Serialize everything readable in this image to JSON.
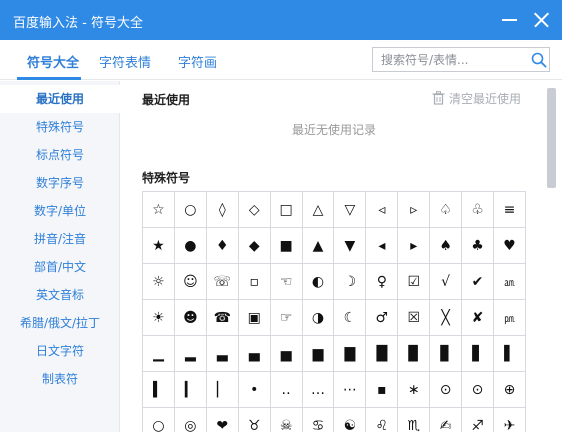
{
  "window": {
    "title": "百度输入法 - 符号大全"
  },
  "tabs": [
    {
      "label": "符号大全",
      "active": true
    },
    {
      "label": "字符表情",
      "active": false
    },
    {
      "label": "字符画",
      "active": false
    }
  ],
  "search": {
    "placeholder": "搜索符号/表情...",
    "value": ""
  },
  "sidebar": {
    "items": [
      {
        "label": "最近使用",
        "active": true
      },
      {
        "label": "特殊符号"
      },
      {
        "label": "标点符号"
      },
      {
        "label": "数字序号"
      },
      {
        "label": "数字/单位"
      },
      {
        "label": "拼音/注音"
      },
      {
        "label": "部首/中文"
      },
      {
        "label": "英文音标"
      },
      {
        "label": "希腊/俄文/拉丁"
      },
      {
        "label": "日文字符"
      },
      {
        "label": "制表符"
      }
    ]
  },
  "recent": {
    "title": "最近使用",
    "clear_label": "清空最近使用",
    "empty_text": "最近无使用记录"
  },
  "special": {
    "title": "特殊符号",
    "rows": [
      [
        "☆",
        "○",
        "◊",
        "◇",
        "□",
        "△",
        "▽",
        "◃",
        "▹",
        "♤",
        "♧",
        "≡"
      ],
      [
        "★",
        "●",
        "♦",
        "◆",
        "■",
        "▲",
        "▼",
        "◂",
        "▸",
        "♠",
        "♣",
        "♥"
      ],
      [
        "☼",
        "☺",
        "☏",
        "▫",
        "☜",
        "◐",
        "☽",
        "♀",
        "☑",
        "√",
        "✔",
        "㏂"
      ],
      [
        "☀",
        "☻",
        "☎",
        "▣",
        "☞",
        "◑",
        "☾",
        "♂",
        "☒",
        "╳",
        "✘",
        "㏘"
      ],
      [
        "▁",
        "▂",
        "▃",
        "▄",
        "▅",
        "▆",
        "▇",
        "█",
        "▉",
        "▊",
        "▋",
        "▌"
      ],
      [
        "▍",
        "▎",
        "▏",
        "•",
        "‥",
        "…",
        "⋯",
        "▪",
        "∗",
        "⊙",
        "⊙",
        "⊕"
      ],
      [
        "○",
        "◎",
        "❤",
        "♉",
        "☠",
        "♋",
        "☯",
        "♌",
        "♏",
        "✍",
        "♐",
        "✈"
      ]
    ]
  },
  "colors": {
    "titlebar": "#2f8ae6",
    "accent": "#2f7fd8",
    "sidebar_bg": "#f4f6f9"
  },
  "icons": {
    "search": "search-icon",
    "trash": "trash-icon",
    "minimize": "minimize-icon",
    "close": "close-icon"
  }
}
